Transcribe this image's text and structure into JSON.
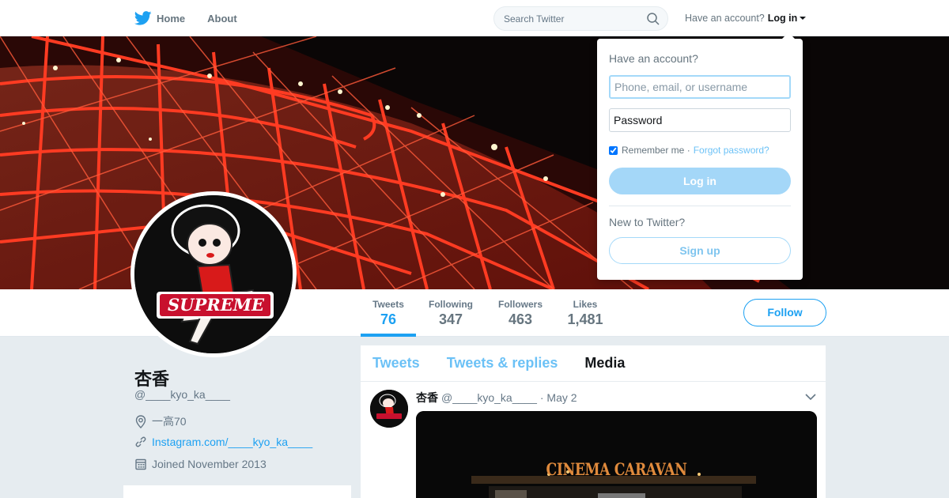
{
  "colors": {
    "accent": "#1da1f2",
    "nav_text": "#66757f",
    "banner_red": "#e0301e",
    "background": "#e6ecf0"
  },
  "nav": {
    "home_label": "Home",
    "about_label": "About",
    "search_placeholder": "Search Twitter",
    "have_account": "Have an account?",
    "login_label": "Log in"
  },
  "profile": {
    "name": "杏香",
    "handle": "@____kyo_ka____",
    "location": "一高70",
    "website": "Instagram.com/____kyo_ka____",
    "joined": "Joined November 2013",
    "avatar_text": "SUPREME"
  },
  "stats": [
    {
      "label": "Tweets",
      "value": "76"
    },
    {
      "label": "Following",
      "value": "347"
    },
    {
      "label": "Followers",
      "value": "463"
    },
    {
      "label": "Likes",
      "value": "1,481"
    }
  ],
  "follow_label": "Follow",
  "tabs": [
    "Tweets",
    "Tweets & replies",
    "Media"
  ],
  "active_tab": "Media",
  "tweet": {
    "name": "杏香",
    "handle": "@____kyo_ka____",
    "date": "· May 2",
    "media_text": "CINEMA CARAVAN"
  },
  "login_dropdown": {
    "title": "Have an account?",
    "username_placeholder": "Phone, email, or username",
    "password_placeholder": "Password",
    "remember_label": "Remember me ·",
    "remember_checked": true,
    "forgot_label": "Forgot password?",
    "login_button": "Log in",
    "new_label": "New to Twitter?",
    "signup_button": "Sign up"
  }
}
